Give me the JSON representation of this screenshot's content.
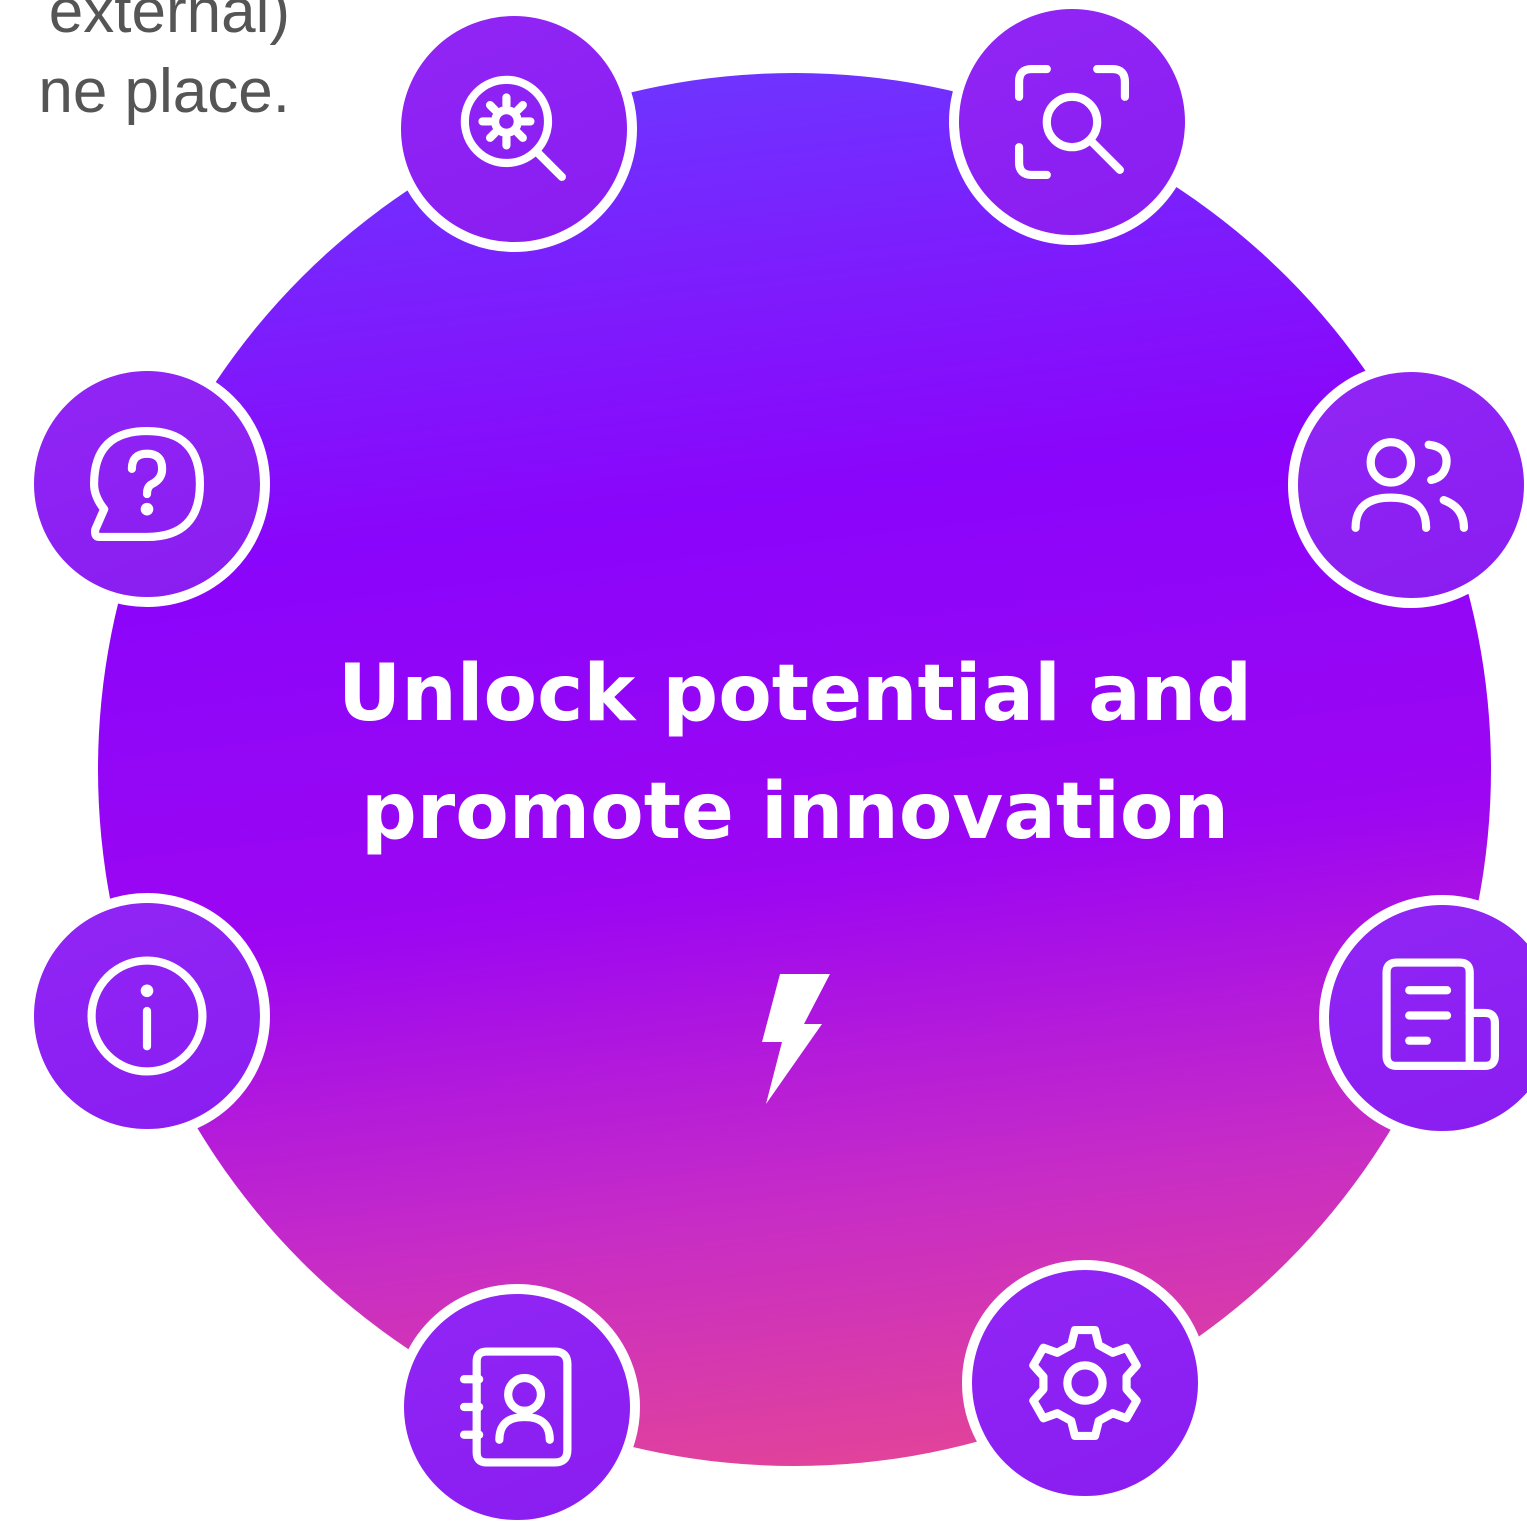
{
  "corner_text": {
    "line1": "external)",
    "line2": "ne place."
  },
  "headline": {
    "line1": "Unlock potential and",
    "line2": "promote innovation"
  },
  "center_icon": "lightning-bolt-icon",
  "colors": {
    "circle_top": "#6a3cff",
    "circle_mid": "#8a05fb",
    "circle_bottom": "#e9498e",
    "node_fill": "#8a1cf0",
    "node_border": "#ffffff",
    "corner_text": "#555555"
  },
  "nodes": [
    {
      "icon": "search-settings-icon"
    },
    {
      "icon": "scan-search-icon"
    },
    {
      "icon": "users-icon"
    },
    {
      "icon": "document-icon"
    },
    {
      "icon": "settings-gear-icon"
    },
    {
      "icon": "contact-book-icon"
    },
    {
      "icon": "info-icon"
    },
    {
      "icon": "help-chat-icon"
    }
  ]
}
